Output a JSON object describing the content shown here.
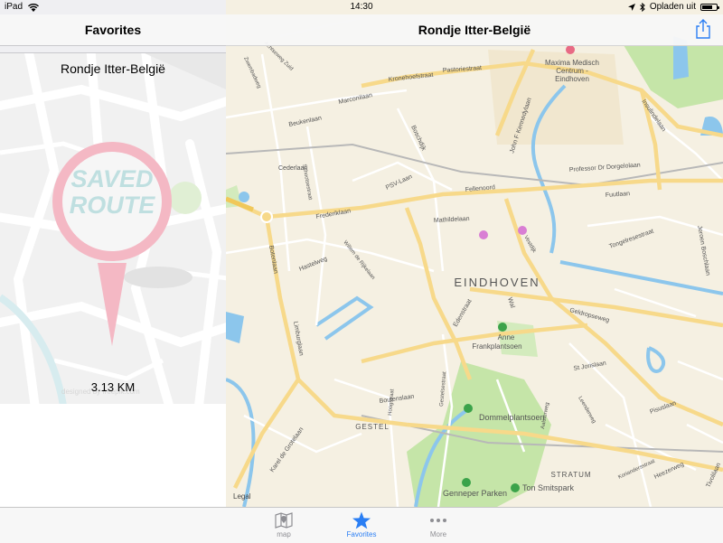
{
  "status_bar": {
    "device": "iPad",
    "time": "14:30",
    "battery_text": "Opladen uit",
    "battery_level": 0.75
  },
  "sidebar": {
    "title": "Favorites",
    "route": {
      "name": "Rondje Itter-België",
      "distance": "3.13 KM",
      "image_text_line1": "SAVED",
      "image_text_line2": "ROUTE",
      "credit": "designed by freepik.com"
    }
  },
  "map_view": {
    "title": "Rondje Itter-België",
    "share_icon": "share-icon",
    "legal": "Legal",
    "labels": {
      "city": "EINDHOVEN",
      "districts": [
        "GESTEL",
        "STRATUM"
      ],
      "pois": [
        "Maxima Medisch",
        "Centrum -",
        "Eindhoven",
        "Anne",
        "Frankplantsoen",
        "Dommelplantsoen",
        "Genneper Parken",
        "Ton Smitspark"
      ],
      "streets": [
        "Zwembadweg",
        "Achtseweg Zuid",
        "Kronehoefstraat",
        "Pastoriestraat",
        "Marconilaan",
        "Beukenlaan",
        "John F Kennedylaan",
        "Insulindelaan",
        "Boschdijk",
        "Cederlaan",
        "Fellenoord",
        "Professor Dr Dorgelolaan",
        "Fuutlaan",
        "Schootsestraat",
        "Frederiklaan",
        "PSV-Laan",
        "Mathildelaan",
        "Vestdijk",
        "Tongelresestraat",
        "Jeroen Boschlaan",
        "Botenlaan",
        "Hastelweg",
        "Willem de Rijkelaan",
        "Wal",
        "Edenstraat",
        "Geldropseweg",
        "Limburglaan",
        "St Jorislaan",
        "Hoogstraat",
        "Gestelsestraat",
        "Boutenslaan",
        "Leenderweg",
        "Aalsterweg",
        "Pisuslaan",
        "Karel de Grotelaan",
        "Heezerweg",
        "Tivolilaan",
        "Koriandersstraat"
      ]
    }
  },
  "tab_bar": {
    "tabs": [
      {
        "label": "map",
        "icon": "map-icon",
        "active": false
      },
      {
        "label": "Favorites",
        "icon": "star-icon",
        "active": true
      },
      {
        "label": "More",
        "icon": "more-icon",
        "active": false
      }
    ]
  },
  "colors": {
    "accent": "#2a7ef4",
    "map_background": "#f5f0e2",
    "map_road": "#ffffff",
    "map_major_road": "#f7d98a",
    "map_water": "#8cc6ec",
    "map_park": "#c5e5a8",
    "route_pin": "#f4b8c4"
  }
}
